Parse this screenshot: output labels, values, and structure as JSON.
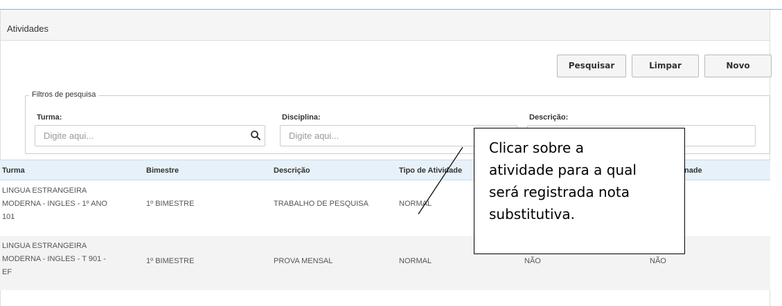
{
  "panel": {
    "title": "Atividades"
  },
  "toolbar": {
    "search_label": "Pesquisar",
    "clear_label": "Limpar",
    "new_label": "Novo"
  },
  "filters": {
    "legend": "Filtros de pesquisa",
    "turma_label": "Turma:",
    "turma_placeholder": "Digite aqui...",
    "disciplina_label": "Disciplina:",
    "disciplina_placeholder": "Digite aqui...",
    "descricao_label": "Descrição:"
  },
  "table": {
    "headers": [
      "Turma",
      "Bimestre",
      "Descrição",
      "Tipo de Atividade",
      "nade"
    ],
    "rows": [
      {
        "turma": "LINGUA ESTRANGEIRA\nMODERNA - INGLES - 1º ANO\n101",
        "bimestre": "1º BIMESTRE",
        "descricao": "TRABALHO DE PESQUISA",
        "tipo": "NORMAL"
      },
      {
        "turma": "LINGUA ESTRANGEIRA\nMODERNA - INGLES - T 901 -\nEF",
        "bimestre": "1º BIMESTRE",
        "descricao": "PROVA MENSAL",
        "tipo": "NORMAL",
        "col5": "NÃO",
        "col6": "NÃO"
      }
    ]
  },
  "callout": {
    "text": "Clicar sobre a\natividade para a qual\nserá registrada nota\nsubstitutiva."
  },
  "colors": {
    "header_bg": "#e7f1f9",
    "panel_header_bg": "#f5f5f5",
    "alt_row_bg": "#f3f3f3"
  },
  "icons": {
    "search": "search-icon"
  }
}
